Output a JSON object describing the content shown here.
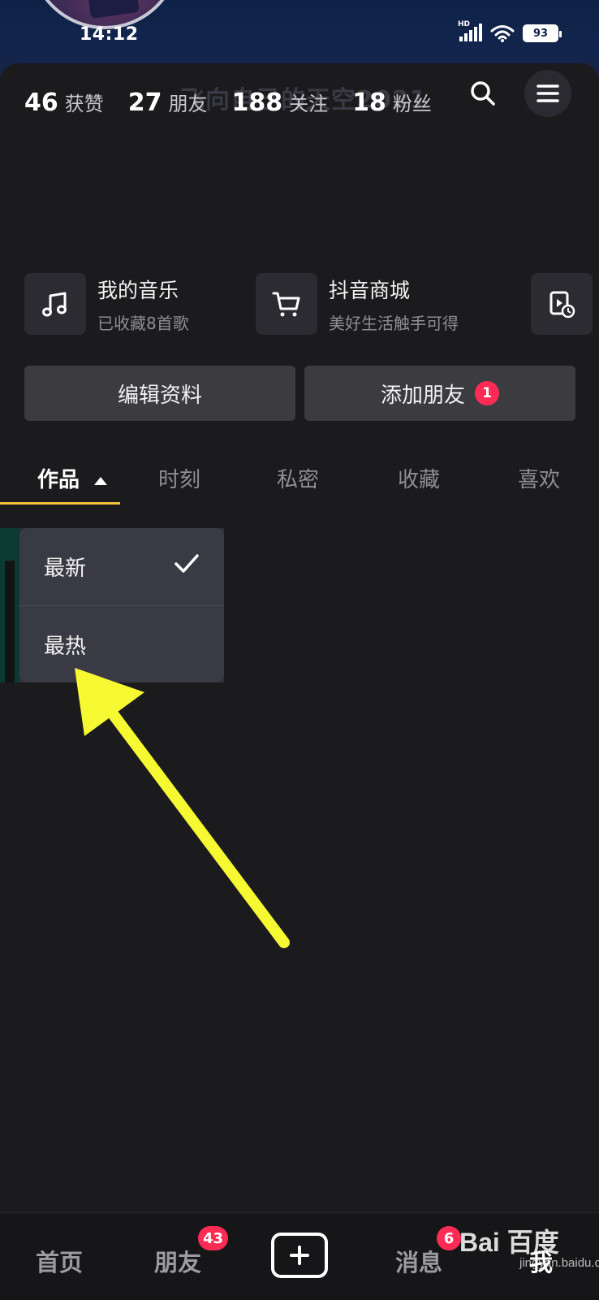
{
  "status_bar": {
    "time": "14:12",
    "network": "HD",
    "battery": "93"
  },
  "profile": {
    "name": "飞向自己的天空2021",
    "stats": [
      {
        "num": "46",
        "label": "获赞"
      },
      {
        "num": "27",
        "label": "朋友"
      },
      {
        "num": "188",
        "label": "关注"
      },
      {
        "num": "18",
        "label": "粉丝"
      }
    ]
  },
  "features": [
    {
      "title": "我的音乐",
      "subtitle": "已收藏8首歌",
      "icon": "music-note-icon"
    },
    {
      "title": "抖音商城",
      "subtitle": "美好生活触手可得",
      "icon": "cart-icon"
    },
    {
      "title": "",
      "subtitle": "",
      "icon": "video-history-icon"
    }
  ],
  "actions": {
    "edit_profile": "编辑资料",
    "add_friend": "添加朋友",
    "add_friend_badge": "1"
  },
  "tabs": [
    "作品",
    "时刻",
    "私密",
    "收藏",
    "喜欢"
  ],
  "sort_menu": {
    "options": [
      "最新",
      "最热"
    ],
    "selected": "最新"
  },
  "bottom_nav": {
    "home": "首页",
    "friends": "朋友",
    "friends_badge": "43",
    "messages": "消息",
    "messages_badge": "6",
    "me": "我"
  },
  "watermark": {
    "brand": "Bai 百度",
    "url": "jingyan.baidu.com"
  },
  "colors": {
    "accent_red": "#fe2c55",
    "tab_underline": "#f3c23a",
    "annotation_arrow": "#f6f931"
  }
}
